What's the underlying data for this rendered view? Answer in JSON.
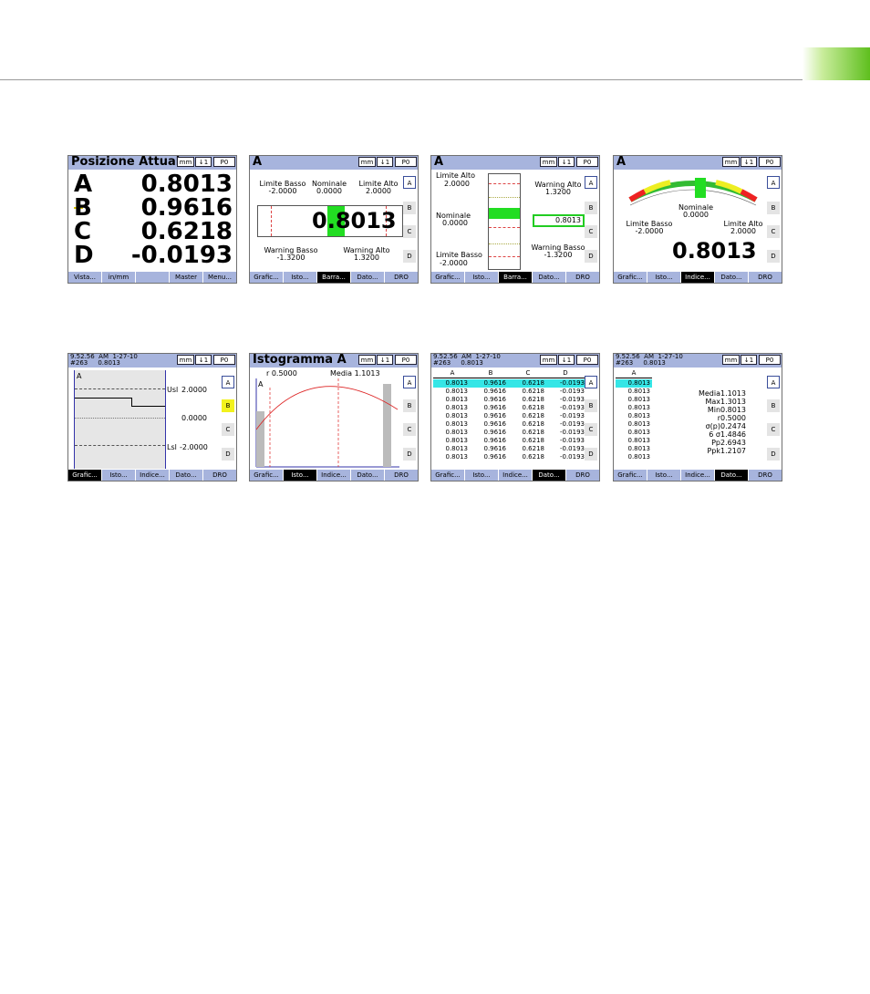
{
  "colors": {
    "header": "#a7b4dd",
    "highlight": "#35e6e6",
    "bar_green": "#22dd22",
    "yellow": "#f2f21d"
  },
  "common": {
    "hdr_mm": "mm",
    "hdr_icon": "↓1",
    "hdr_p": "P0",
    "side": [
      "A",
      "B",
      "C",
      "D"
    ],
    "stamp": "9.52.56  AM  1-27-10\n#263     0.8013"
  },
  "s1": {
    "title": "Posizione Attuale",
    "rows": [
      {
        "label": "A",
        "value": "0.8013"
      },
      {
        "label": "B",
        "value": "0.9616"
      },
      {
        "label": "C",
        "value": "0.6218"
      },
      {
        "label": "D",
        "value": "-0.0193"
      }
    ],
    "foot": [
      "Vista...",
      "in/mm",
      "",
      "Master",
      "Menu..."
    ]
  },
  "s2": {
    "title": "A",
    "ll": "Limite  Basso",
    "ll_v": "-2.0000",
    "nom": "Nominale",
    "nom_v": "0.0000",
    "lh": "Limite  Alto",
    "lh_v": "2.0000",
    "big": "0.8013",
    "wl": "Warning  Basso",
    "wl_v": "-1.3200",
    "wh": "Warning  Alto",
    "wh_v": "1.3200",
    "foot": [
      "Grafic...",
      "Isto...",
      "Barra...",
      "Dato...",
      "DRO"
    ]
  },
  "s3": {
    "title": "A",
    "lh": "Limite  Alto",
    "lh_v": "2.0000",
    "wh": "Warning  Alto",
    "wh_v": "1.3200",
    "nom": "Nominale",
    "nom_v": "0.0000",
    "val": "0.8013",
    "wl": "Warning  Basso",
    "wl_v": "-1.3200",
    "ll": "Limite  Basso",
    "ll_v": "-2.0000",
    "foot": [
      "Grafic...",
      "Isto...",
      "Barra...",
      "Dato...",
      "DRO"
    ]
  },
  "s4": {
    "title": "A",
    "nom": "Nominale",
    "nom_v": "0.0000",
    "ll": "Limite  Basso",
    "ll_v": "-2.0000",
    "lh": "Limite  Alto",
    "lh_v": "2.0000",
    "big": "0.8013",
    "foot": [
      "Grafic...",
      "Isto...",
      "Indice...",
      "Dato...",
      "DRO"
    ]
  },
  "s5": {
    "label": "A",
    "usl": "Usl",
    "usl_v": "2.0000",
    "nom_v": "0.0000",
    "lsl": "Lsl",
    "lsl_v": "-2.0000",
    "foot": [
      "Grafic...",
      "Isto...",
      "Indice...",
      "Dato...",
      "DRO"
    ]
  },
  "s6": {
    "title": "Istogramma  A",
    "r": "r  0.5000",
    "media": "Media  1.1013",
    "label": "A",
    "foot": [
      "Grafic...",
      "Isto...",
      "Indice...",
      "Dato...",
      "DRO"
    ]
  },
  "s7": {
    "cols": [
      "A",
      "B",
      "C",
      "D"
    ],
    "rows": [
      [
        "0.8013",
        "0.9616",
        "0.6218",
        "-0.0193"
      ],
      [
        "0.8013",
        "0.9616",
        "0.6218",
        "-0.0193"
      ],
      [
        "0.8013",
        "0.9616",
        "0.6218",
        "-0.0193"
      ],
      [
        "0.8013",
        "0.9616",
        "0.6218",
        "-0.0193"
      ],
      [
        "0.8013",
        "0.9616",
        "0.6218",
        "-0.0193"
      ],
      [
        "0.8013",
        "0.9616",
        "0.6218",
        "-0.0193"
      ],
      [
        "0.8013",
        "0.9616",
        "0.6218",
        "-0.0193"
      ],
      [
        "0.8013",
        "0.9616",
        "0.6218",
        "-0.0193"
      ],
      [
        "0.8013",
        "0.9616",
        "0.6218",
        "-0.0193"
      ],
      [
        "0.8013",
        "0.9616",
        "0.6218",
        "-0.0193"
      ]
    ],
    "foot": [
      "Grafic...",
      "Isto...",
      "Indice...",
      "Dato...",
      "DRO"
    ]
  },
  "s8": {
    "col": "A",
    "rows": [
      "0.8013",
      "0.8013",
      "0.8013",
      "0.8013",
      "0.8013",
      "0.8013",
      "0.8013",
      "0.8013",
      "0.8013",
      "0.8013"
    ],
    "stats": [
      "Media1.1013",
      "Max1.3013",
      "Min0.8013",
      "r0.5000",
      "σ(p)0.2474",
      "6  σ1.4846",
      "Pp2.6943",
      "Ppk1.2107"
    ],
    "foot": [
      "Grafic...",
      "Isto...",
      "Indice...",
      "Dato...",
      "DRO"
    ]
  }
}
